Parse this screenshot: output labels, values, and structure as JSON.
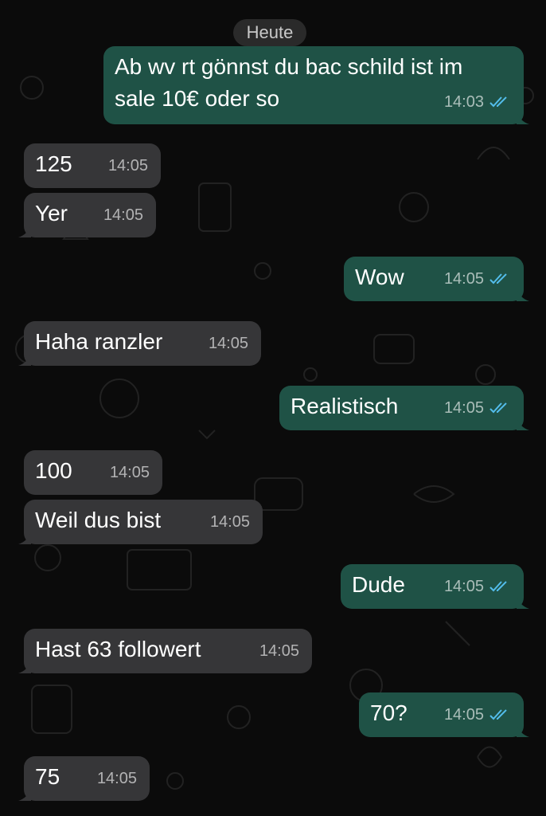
{
  "chat": {
    "date_label": "Heute",
    "colors": {
      "background": "#0b0b0b",
      "incoming_bubble": "#363638",
      "outgoing_bubble": "#1f5246",
      "read_ticks": "#53bdeb"
    },
    "messages": [
      {
        "direction": "outgoing",
        "text": "Ab wv rt gönnst du bac schild ist im\nsale 10€ oder so",
        "time": "14:03",
        "status": "read"
      },
      {
        "direction": "incoming",
        "text": "125",
        "time": "14:05"
      },
      {
        "direction": "incoming",
        "text": "Yer",
        "time": "14:05"
      },
      {
        "direction": "outgoing",
        "text": "Wow",
        "time": "14:05",
        "status": "read"
      },
      {
        "direction": "incoming",
        "text": "Haha ranzler",
        "time": "14:05"
      },
      {
        "direction": "outgoing",
        "text": "Realistisch",
        "time": "14:05",
        "status": "read"
      },
      {
        "direction": "incoming",
        "text": "100",
        "time": "14:05"
      },
      {
        "direction": "incoming",
        "text": "Weil dus bist",
        "time": "14:05"
      },
      {
        "direction": "outgoing",
        "text": "Dude",
        "time": "14:05",
        "status": "read"
      },
      {
        "direction": "incoming",
        "text": "Hast 63 followert",
        "time": "14:05"
      },
      {
        "direction": "outgoing",
        "text": "70?",
        "time": "14:05",
        "status": "read"
      },
      {
        "direction": "incoming",
        "text": "75",
        "time": "14:05"
      }
    ]
  }
}
